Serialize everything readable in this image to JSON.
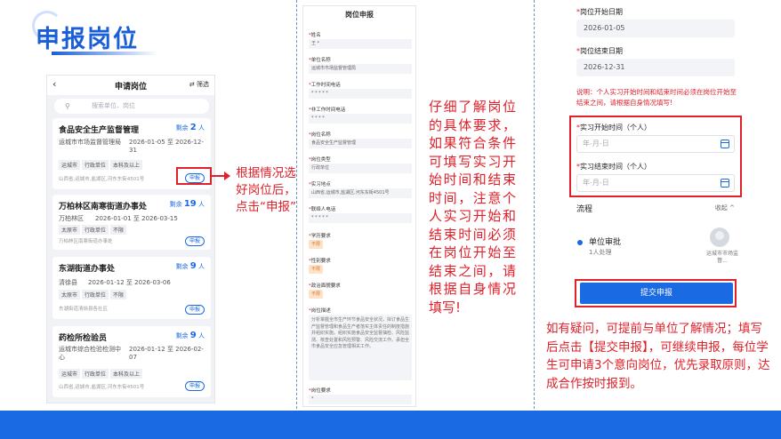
{
  "page_title": "申报岗位",
  "colors": {
    "accent": "#1a6ae3",
    "highlight": "#e0202a"
  },
  "phone1": {
    "header_title": "申请岗位",
    "filter_label": "筛选",
    "search_placeholder": "搜索单位、岗位",
    "jobs": [
      {
        "title": "食品安全生产监督管理",
        "vacancy_prefix": "剩余",
        "vacancy_count": "2",
        "vacancy_unit": "人",
        "org": "运城市市场监督管理局",
        "period": "2026-01-05 至 2026-12-31",
        "tags": [
          "运城市",
          "行政单位",
          "本科及以上"
        ],
        "address": "山西省,运城市,盐湖区,河东东街4501号",
        "apply": "申报"
      },
      {
        "title": "万柏林区南寒街道办事处",
        "vacancy_prefix": "剩余",
        "vacancy_count": "19",
        "vacancy_unit": "人",
        "org": "万柏林区",
        "period": "2026-01-01 至 2026-03-15",
        "tags": [
          "太原市",
          "行政单位",
          "不限"
        ],
        "address": "万柏林区南寒街道办事处",
        "apply": "申报"
      },
      {
        "title": "东湖街道办事处",
        "vacancy_prefix": "剩余",
        "vacancy_count": "9",
        "vacancy_unit": "人",
        "org": "清徐县",
        "period": "2026-01-12 至 2026-03-06",
        "tags": [
          "太原市",
          "行政单位",
          "不限"
        ],
        "address": "东湖街道清徐县各社区",
        "apply": "申报"
      },
      {
        "title": "药检所检验员",
        "vacancy_prefix": "剩余",
        "vacancy_count": "9",
        "vacancy_unit": "人",
        "org": "运城市综合检验检测中心",
        "period": "2026-01-12 至 2026-02-07",
        "tags": [
          "运城市",
          "行政单位",
          "本科及以上"
        ],
        "address": "山西省,运城市,盐湖区,河东东街4501号",
        "apply": "申报"
      }
    ]
  },
  "note1": "根据情况选好岗位后，点击“申报”",
  "phone2": {
    "header_title": "岗位申报",
    "fields": [
      {
        "label": "姓名",
        "value": "王 *"
      },
      {
        "label": "单位名称",
        "value": "运城市市场监督管理局"
      },
      {
        "label": "工作时间电话",
        "value": "* * * * *"
      },
      {
        "label": "非工作时间电话",
        "value": "* * * *"
      },
      {
        "label": "岗位名称",
        "value": "食品安全生产监督管理"
      },
      {
        "label": "岗位类型",
        "value": "行政单位"
      },
      {
        "label": "实习地点",
        "value": "山西省,运城市,盐湖区,河东东街4501号"
      },
      {
        "label": "联络人电话",
        "value": "* * * * *"
      }
    ],
    "requirements": [
      {
        "label": "学历要求",
        "value": "不限"
      },
      {
        "label": "性别要求",
        "value": "不限"
      },
      {
        "label": "政治面貌要求",
        "value": "不限"
      }
    ],
    "desc_label": "岗位描述",
    "desc_text": "分析掌握全市生产环节食品安全状况，拟订食品生产监督管理和食品生产者落实主体责任的制度措施并组织实施。组织实施食品安全监督抽检、风险监测、核查处置和风险预警、风险交流工作。承担全市食品安全应急管理相关工作。",
    "req_label": "岗位要求",
    "req_value": "*"
  },
  "note2": "仔细了解岗位的具体要求，如果符合条件可填写实习开始时间和结束时间，注意个人实习开始和结束时间必须在岗位开始至结束之间，请根据自身情况填写!",
  "phone3": {
    "start_label": "岗位开始日期",
    "start_value": "2026-01-05",
    "end_label": "岗位结束日期",
    "end_value": "2026-12-31",
    "notice": "说明：个人实习开始时间和结束时间必须在岗位开始至结束之间，请根据自身情况填写!",
    "intern_start_label": "实习开始时间（个人）",
    "intern_start_placeholder": "年-月-日",
    "intern_end_label": "实习结束时间（个人）",
    "intern_end_placeholder": "年-月-日",
    "flow_title": "流程",
    "flow_collapse": "收起 ^",
    "flow_step": "单位审批",
    "flow_step_sub": "1人处理",
    "approver": "运城市市场监督...",
    "submit": "提交申报"
  },
  "note3": "如有疑问，可提前与单位了解情况；填写后点击【提交申报】，可继续申报，每位学生可申请3个意向岗位，优先录取原则，达成合作按时报到。"
}
